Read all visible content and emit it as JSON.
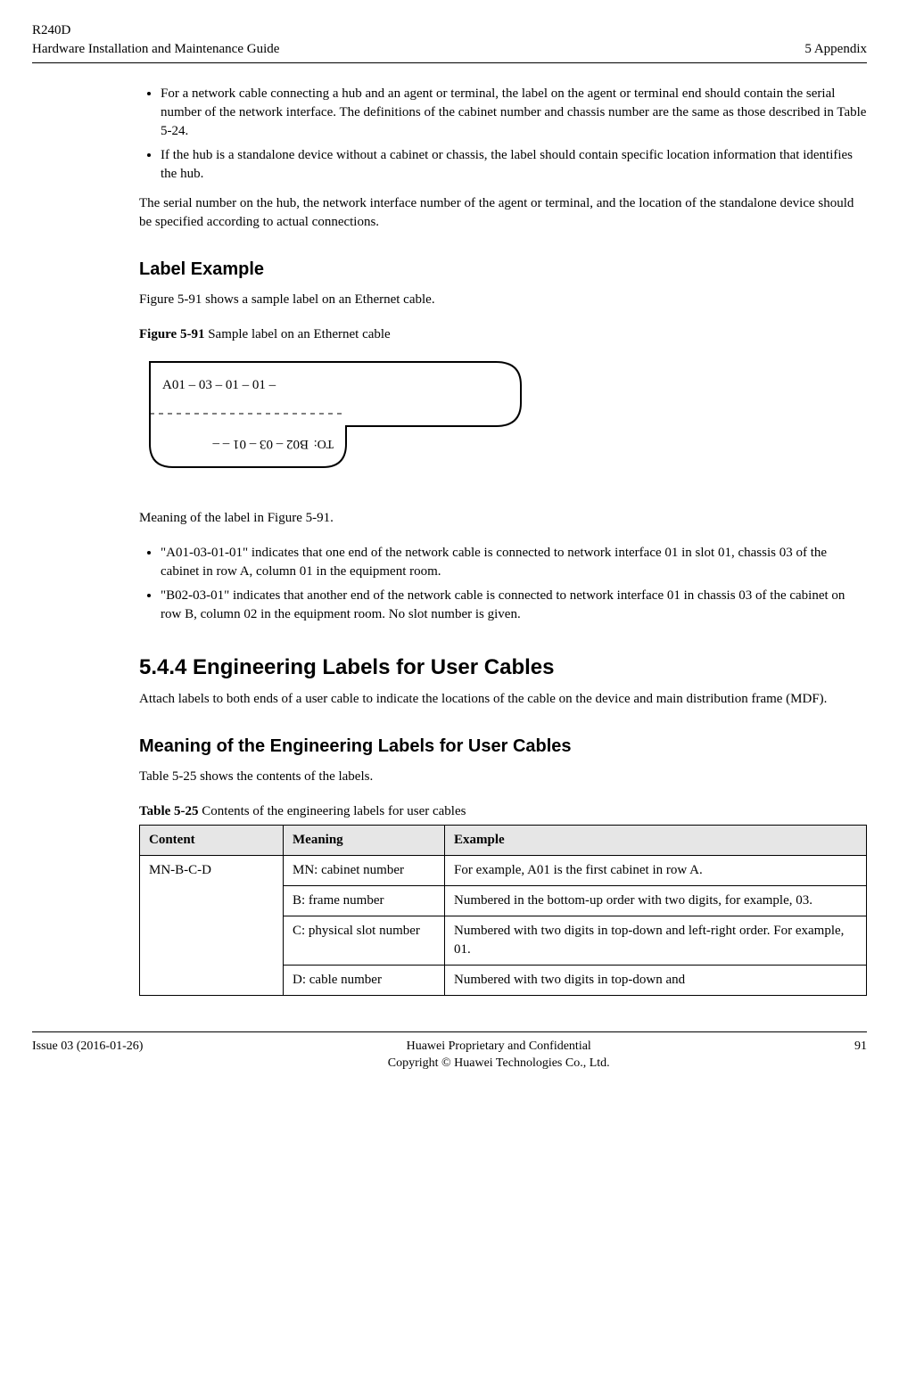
{
  "header": {
    "product": "R240D",
    "doc_title": "Hardware Installation and Maintenance Guide",
    "chapter": "5 Appendix"
  },
  "top_bullets": [
    "For a network cable connecting a hub and an agent or terminal, the label on the agent or terminal end should contain the serial number of the network interface. The definitions of the cabinet number and chassis number are the same as those described in Table 5-24.",
    "If the hub is a standalone device without a cabinet or chassis, the label should contain specific location information that identifies the hub."
  ],
  "top_para": "The serial number on the hub, the network interface number of the agent or terminal, and the location of the standalone device should be specified according to actual connections.",
  "label_example_heading": "Label Example",
  "label_example_intro": "Figure 5-91 shows a sample label on an Ethernet cable.",
  "figure": {
    "label": "Figure 5-91",
    "caption": " Sample label on an Ethernet cable",
    "top_text": "A01 –  03  – 01 – 01 –",
    "bottom_text_to": "TO:",
    "bottom_text_code": "B02 – 03 – 01 –       –"
  },
  "meaning_intro": "Meaning of the label in Figure 5-91.",
  "meaning_bullets": [
    "\"A01-03-01-01\" indicates that one end of the network cable is connected to network interface 01 in slot 01, chassis 03 of the cabinet in row A, column 01 in the equipment room.",
    "\"B02-03-01\" indicates that another end of the network cable is connected to network interface 01 in chassis 03 of the cabinet on row B, column 02 in the equipment room. No slot number is given."
  ],
  "section_544": {
    "title": "5.4.4 Engineering Labels for User Cables",
    "para": "Attach labels to both ends of a user cable to indicate the locations of the cable on the device and main distribution frame (MDF).",
    "subheading": "Meaning of the Engineering Labels for User Cables",
    "subpara": "Table 5-25 shows the contents of the labels."
  },
  "table": {
    "label": "Table 5-25",
    "caption": " Contents of the engineering labels for user cables",
    "headers": [
      "Content",
      "Meaning",
      "Example"
    ],
    "content_cell": "MN-B-C-D",
    "rows": [
      {
        "meaning": "MN: cabinet number",
        "example": "For example, A01 is the first cabinet in row A."
      },
      {
        "meaning": "B: frame number",
        "example": "Numbered in the bottom-up order with two digits, for example, 03."
      },
      {
        "meaning": "C: physical slot number",
        "example": "Numbered with two digits in top-down and left-right order. For example, 01."
      },
      {
        "meaning": "D: cable number",
        "example": "Numbered with two digits in top-down and"
      }
    ]
  },
  "footer": {
    "issue": "Issue 03 (2016-01-26)",
    "center_top": "Huawei Proprietary and Confidential",
    "center_bottom": "Copyright © Huawei Technologies Co., Ltd.",
    "page": "91"
  }
}
